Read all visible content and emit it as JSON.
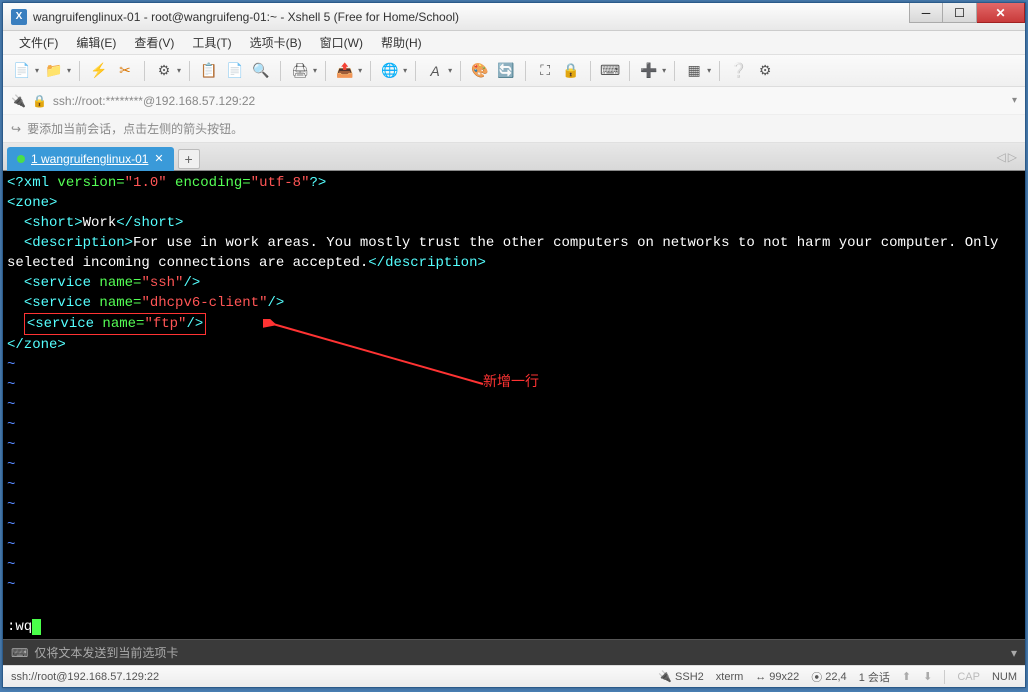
{
  "titlebar": {
    "text": "wangruifenglinux-01 - root@wangruifeng-01:~ - Xshell 5 (Free for Home/School)"
  },
  "menu": {
    "file": "文件(F)",
    "edit": "编辑(E)",
    "view": "查看(V)",
    "tools": "工具(T)",
    "tabs": "选项卡(B)",
    "window": "窗口(W)",
    "help": "帮助(H)"
  },
  "addressbar": {
    "lock_icon": "🔒",
    "text": "ssh://root:********@192.168.57.129:22"
  },
  "tipbar": {
    "text": "要添加当前会话，点击左侧的箭头按钮。"
  },
  "tab": {
    "label": "1 wangruifenglinux-01"
  },
  "terminal": {
    "xml_decl_open": "<?xml",
    "xml_version_key": " version=",
    "xml_version_val": "\"1.0\"",
    "xml_encoding_key": " encoding=",
    "xml_encoding_val": "\"utf-8\"",
    "xml_decl_close": "?>",
    "zone_open": "<zone>",
    "short_open": "<short>",
    "short_text": "Work",
    "short_close": "</short>",
    "desc_open": "<description>",
    "desc_text": "For use in work areas. You mostly trust the other computers on networks to not harm your computer. Only selected incoming connections are accepted.",
    "desc_close": "</description>",
    "svc1_open": "<service",
    "svc_name_key": " name=",
    "svc1_val": "\"ssh\"",
    "svc_close": "/>",
    "svc2_val": "\"dhcpv6-client\"",
    "svc3_val": "\"ftp\"",
    "zone_close": "</zone>",
    "tilde": "~",
    "command": ":wq"
  },
  "annotation": {
    "text": "新增一行"
  },
  "inputbar": {
    "text": "仅将文本发送到当前选项卡"
  },
  "statusbar": {
    "left": "ssh://root@192.168.57.129:22",
    "proto": "SSH2",
    "term": "xterm",
    "size": "99x22",
    "pos": "22,4",
    "sessions": "1 会话",
    "cap": "CAP",
    "num": "NUM"
  }
}
